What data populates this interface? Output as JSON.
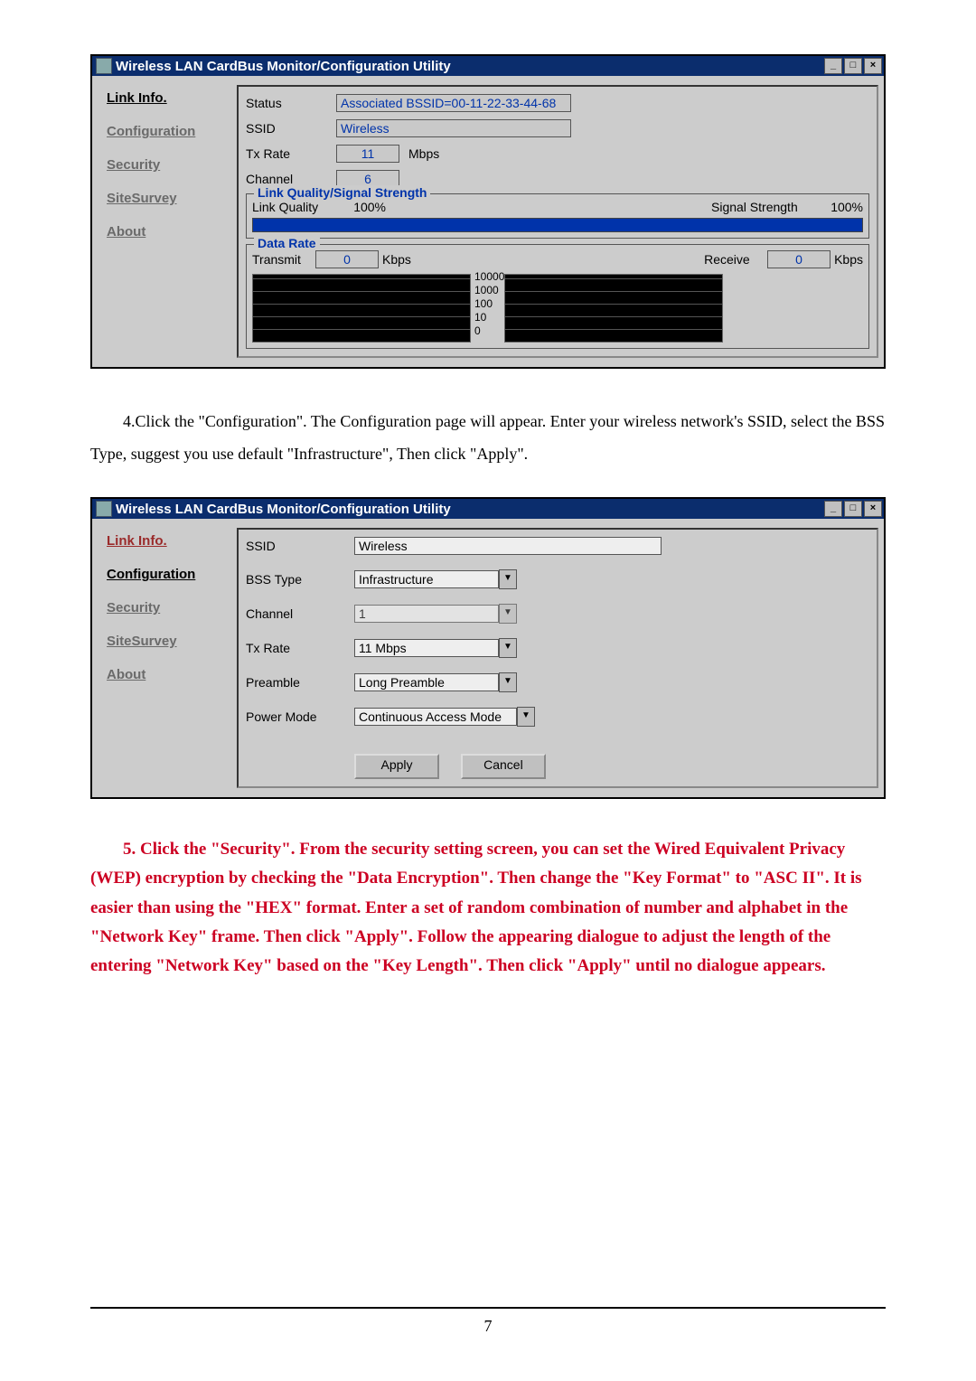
{
  "window_title": "Wireless LAN CardBus Monitor/Configuration Utility",
  "btn_min": "_",
  "btn_max": "□",
  "btn_close": "×",
  "nav": {
    "link_info": "Link Info.",
    "configuration": "Configuration",
    "security": "Security",
    "sitesurvey": "SiteSurvey",
    "about": "About"
  },
  "linkinfo": {
    "lbl_status": "Status",
    "status_val": "Associated BSSID=00-11-22-33-44-68",
    "lbl_ssid": "SSID",
    "ssid_val": "Wireless",
    "lbl_txrate": "Tx Rate",
    "txrate_val": "11",
    "txrate_unit": "Mbps",
    "lbl_channel": "Channel",
    "channel_val": "6",
    "legend_quality": "Link Quality/Signal Strength",
    "lbl_linkquality": "Link Quality",
    "linkquality_val": "100%",
    "lbl_signal": "Signal Strength",
    "signal_val": "100%",
    "legend_datarate": "Data Rate",
    "lbl_transmit": "Transmit",
    "transmit_val": "0",
    "lbl_receive": "Receive",
    "receive_val": "0",
    "unit_kbps": "Kbps",
    "scale5": "10000",
    "scale4": "1000",
    "scale3": "100",
    "scale2": "10",
    "scale1": "0"
  },
  "para4": "4.Click the \"Configuration\". The Configuration page will appear. Enter your wireless network's SSID, select the BSS Type, suggest you use default \"Infrastructure\", Then click \"Apply\".",
  "config": {
    "lbl_ssid": "SSID",
    "ssid_val": "Wireless",
    "lbl_bsstype": "BSS Type",
    "bsstype_val": "Infrastructure",
    "lbl_channel": "Channel",
    "channel_val": "1",
    "lbl_txrate": "Tx Rate",
    "txrate_val": "11 Mbps",
    "lbl_preamble": "Preamble",
    "preamble_val": "Long Preamble",
    "lbl_powermode": "Power Mode",
    "powermode_val": "Continuous Access Mode",
    "btn_apply": "Apply",
    "btn_cancel": "Cancel"
  },
  "para5": "5. Click the \"Security\". From the security setting screen, you can set the Wired Equivalent Privacy (WEP) encryption by checking the \"Data Encryption\".    Then change the \"Key Format\" to \"ASC II\".    It is easier than using the \"HEX\" format.    Enter a set of random combination of number and alphabet in the \"Network Key\" frame.    Then click \"Apply\".    Follow the appearing dialogue to adjust the length of the entering \"Network Key\" based on the \"Key Length\".    Then click \"Apply\" until no dialogue appears.",
  "page_number": "7"
}
